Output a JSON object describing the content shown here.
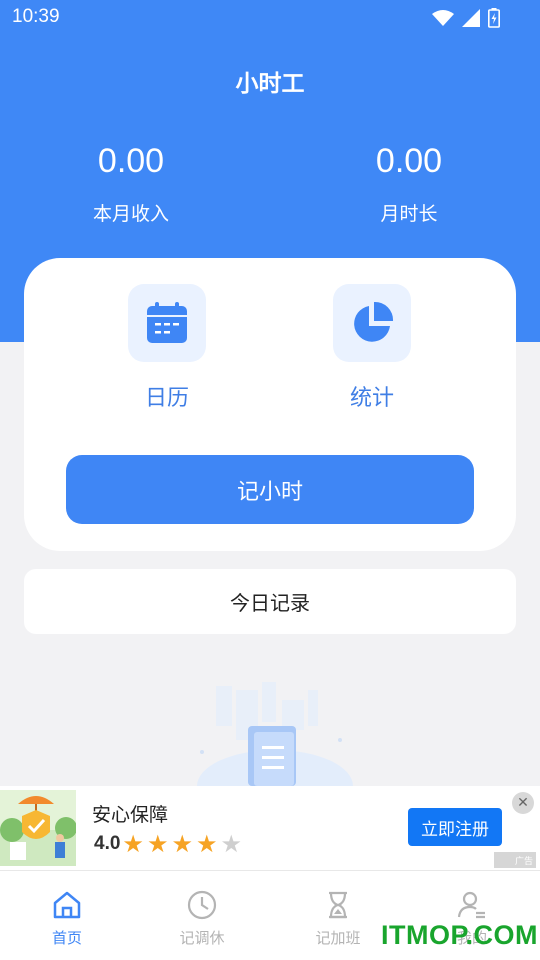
{
  "status_bar": {
    "time": "10:39"
  },
  "header": {
    "title": "小时工"
  },
  "stats": {
    "income_value": "0.00",
    "income_label": "本月收入",
    "hours_value": "0.00",
    "hours_label": "月时长"
  },
  "shortcuts": {
    "calendar_label": "日历",
    "stats_label": "统计"
  },
  "record_button_label": "记小时",
  "today_record_label": "今日记录",
  "ad": {
    "title": "安心保障",
    "rating": "4.0",
    "stars_filled": 4,
    "stars_total": 5,
    "cta_label": "立即注册",
    "badge": "广告",
    "close_glyph": "✕"
  },
  "tabs": [
    {
      "label": "首页",
      "icon": "home-icon",
      "active": true
    },
    {
      "label": "记调休",
      "icon": "clock-icon",
      "active": false
    },
    {
      "label": "记加班",
      "icon": "hourglass-icon",
      "active": false
    },
    {
      "label": "我的",
      "icon": "user-icon",
      "active": false
    }
  ],
  "watermark": "ITMOP.COM",
  "colors": {
    "primary": "#3f88f6",
    "button": "#3f86f5",
    "tile_bg": "#eaf2ff",
    "star": "#f6a324",
    "cta": "#1277f5",
    "watermark": "#19a52d"
  }
}
